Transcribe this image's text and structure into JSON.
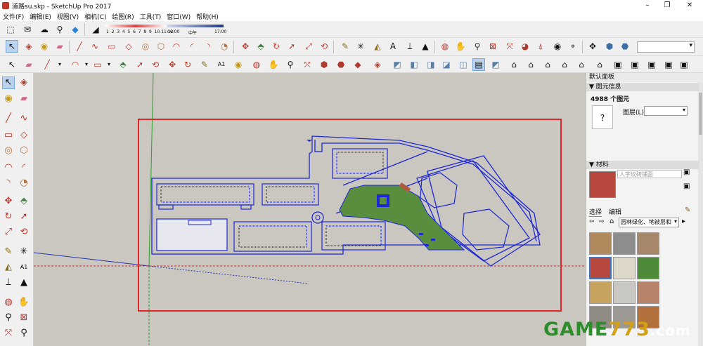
{
  "window": {
    "title": "道路su.skp - SketchUp Pro 2017",
    "minimize": "–",
    "maximize": "❐",
    "close": "✕"
  },
  "menu": [
    "文件(F)",
    "编辑(E)",
    "视图(V)",
    "相机(C)",
    "绘图(R)",
    "工具(T)",
    "窗口(W)",
    "帮助(H)"
  ],
  "shadow_bar": {
    "months": "1  2  3  4  5  6  7  8  9  10 11 12",
    "time_start": "06:00",
    "time_mid": "中午",
    "time_end": "17:00"
  },
  "tray": {
    "title": "默认面板",
    "entity_info": {
      "header": "图元信息",
      "count": "4988 个图元",
      "layer_label": "图层(L):",
      "layer_value": "",
      "unknown_glyph": "?"
    },
    "materials": {
      "header": "材料",
      "current_material": "人字纹砖铺面",
      "tab_select": "选择",
      "tab_edit": "编辑",
      "library": "园林绿化、地被层和",
      "swatch_colors": [
        "#b08a5c",
        "#8d8d8d",
        "#a7876a",
        "#b8483e",
        "#ddd7c7",
        "#4d8a39",
        "#c8a35f",
        "#c9c7c2",
        "#b7826a",
        "#8f8a84",
        "#9c9894",
        "#b3713e"
      ]
    }
  },
  "scene": {
    "blue_color": "#1d27d6",
    "selection_color": "#e1262a",
    "green_color": "#5a8e3f"
  },
  "watermark": {
    "part1": "GAME",
    "part2": "773",
    "part3": ".com"
  }
}
